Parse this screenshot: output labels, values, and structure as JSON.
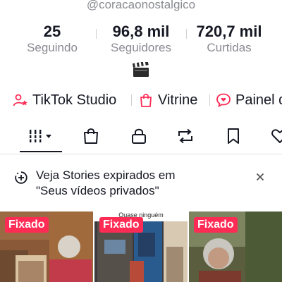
{
  "profile": {
    "username": "@coracaonostalgico"
  },
  "stats": {
    "following": {
      "value": "25",
      "label": "Seguindo"
    },
    "followers": {
      "value": "96,8 mil",
      "label": "Seguidores"
    },
    "likes": {
      "value": "720,7 mil",
      "label": "Curtidas"
    }
  },
  "bio": {
    "emoji_icon": "clapper-board-icon"
  },
  "pills": [
    {
      "label": "TikTok Studio",
      "icon": "person-star-icon"
    },
    {
      "label": "Vitrine",
      "icon": "shopping-bag-icon"
    },
    {
      "label": "Painel d",
      "icon": "chat-heart-icon"
    }
  ],
  "tabs": [
    {
      "icon": "grid-dropdown-icon",
      "active": true
    },
    {
      "icon": "shopping-bag-icon"
    },
    {
      "icon": "lock-icon"
    },
    {
      "icon": "repost-icon"
    },
    {
      "icon": "bookmark-icon"
    },
    {
      "icon": "heart-icon"
    }
  ],
  "notice": {
    "line1": "Veja Stories expirados em",
    "line2": "\"Seus vídeos privados\""
  },
  "videos": [
    {
      "badge": "Fixado",
      "caption": ""
    },
    {
      "badge": "Fixado",
      "caption": "Quase ninguém"
    },
    {
      "badge": "Fixado",
      "caption": ""
    }
  ],
  "colors": {
    "accent": "#fe2c55",
    "text": "#161823",
    "muted": "#8a8b91"
  }
}
